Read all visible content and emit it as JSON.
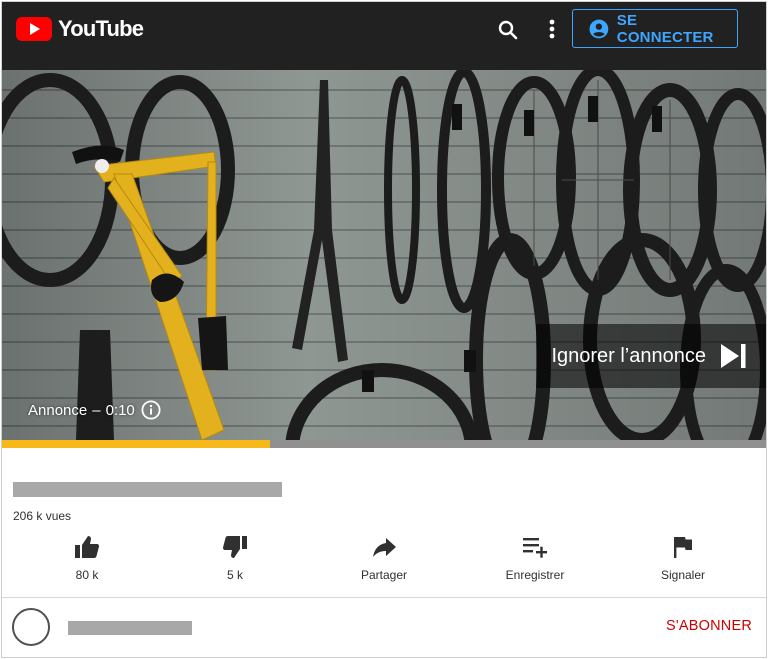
{
  "header": {
    "logo_text": "YouTube",
    "brand_color": "#ff0000",
    "search_icon": "search-icon",
    "more_icon": "more-vertical-icon",
    "signin_label": "SE CONNECTER",
    "signin_icon": "account-circle-icon",
    "accent_color": "#3ea6ff"
  },
  "video": {
    "skip_label": "Ignorer l’annonce",
    "skip_icon": "skip-next-icon",
    "ad_label": "Annonce",
    "ad_separator": "–",
    "ad_time": "0:10",
    "info_icon": "info-icon",
    "ad_progress": 0.35,
    "progress_color": "#f7b919"
  },
  "info": {
    "views": "206 k vues",
    "actions": [
      {
        "icon": "thumb-up-icon",
        "label": "80 k"
      },
      {
        "icon": "thumb-down-icon",
        "label": "5 k"
      },
      {
        "icon": "share-icon",
        "label": "Partager"
      },
      {
        "icon": "playlist-add-icon",
        "label": "Enregistrer"
      },
      {
        "icon": "flag-icon",
        "label": "Signaler"
      }
    ]
  },
  "channel": {
    "subscribe_label": "S'ABONNER",
    "subscribe_color": "#cc0000"
  }
}
